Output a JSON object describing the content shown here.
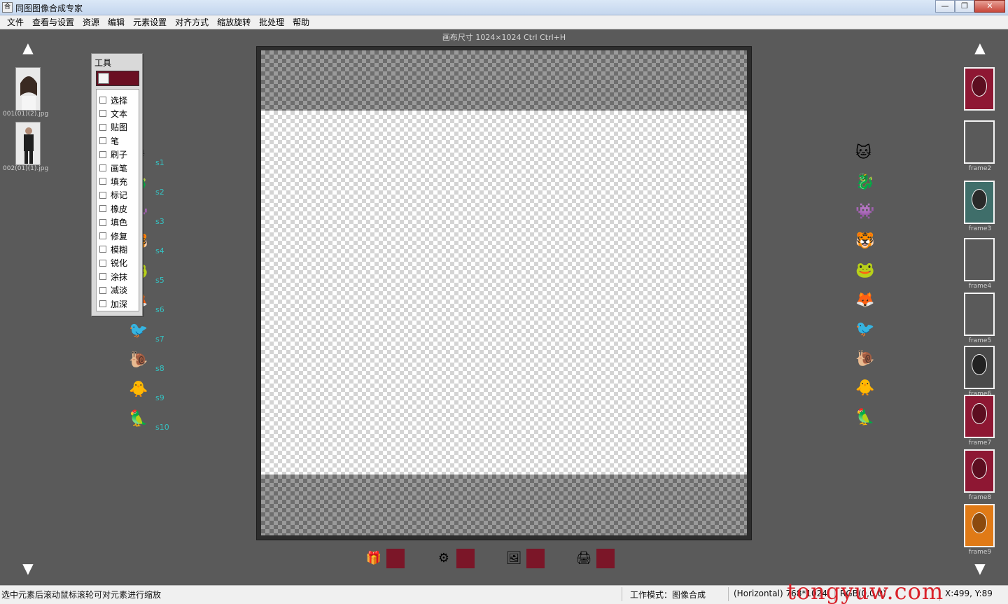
{
  "window": {
    "icon_text": "合",
    "title": "同图图像合成专家",
    "btn_min": "—",
    "btn_max": "❐",
    "btn_close": "✕"
  },
  "menu": [
    "文件",
    "查看与设置",
    "资源",
    "编辑",
    "元素设置",
    "对齐方式",
    "缩放旋转",
    "批处理",
    "帮助"
  ],
  "canvas": {
    "caption": "画布尺寸 1024×1024  Ctrl  Ctrl+H"
  },
  "left_panel": {
    "thumbs": [
      {
        "label": "001(01)(2).jpg",
        "icon": "portrait-photo-icon"
      },
      {
        "label": "002(01)(1).jpg",
        "icon": "groom-photo-icon"
      }
    ]
  },
  "tool_panel": {
    "title": "工具",
    "options": [
      "选择",
      "文本",
      "贴图",
      "笔",
      "刷子",
      "画笔",
      "填充",
      "标记",
      "橡皮",
      "填色",
      "修复",
      "模糊",
      "锐化",
      "涂抹",
      "减淡",
      "加深"
    ]
  },
  "stickers_left": [
    {
      "icon": "purple-cat-icon",
      "glyph": "🐱",
      "label": "s1"
    },
    {
      "icon": "blue-dragon-icon",
      "glyph": "🐉",
      "label": "s2"
    },
    {
      "icon": "cyan-monster-icon",
      "glyph": "👾",
      "label": "s3"
    },
    {
      "icon": "tiger-icon",
      "glyph": "🐯",
      "label": "s4"
    },
    {
      "icon": "frog-icon",
      "glyph": "🐸",
      "label": "s5"
    },
    {
      "icon": "fox-icon",
      "glyph": "🦊",
      "label": "s6"
    },
    {
      "icon": "blue-bird-icon",
      "glyph": "🐦",
      "label": "s7"
    },
    {
      "icon": "snail-icon",
      "glyph": "🐌",
      "label": "s8"
    },
    {
      "icon": "yellow-chick-icon",
      "glyph": "🐥",
      "label": "s9"
    },
    {
      "icon": "parrot-icon",
      "glyph": "🦜",
      "label": "s10"
    }
  ],
  "stickers_right": [
    {
      "icon": "purple-cat-icon",
      "glyph": "🐱"
    },
    {
      "icon": "blue-dragon-icon",
      "glyph": "🐉"
    },
    {
      "icon": "cyan-monster-icon",
      "glyph": "👾"
    },
    {
      "icon": "tiger-icon",
      "glyph": "🐯"
    },
    {
      "icon": "frog-icon",
      "glyph": "🐸"
    },
    {
      "icon": "fox-icon",
      "glyph": "🦊"
    },
    {
      "icon": "blue-bird-icon",
      "glyph": "🐦"
    },
    {
      "icon": "snail-icon",
      "glyph": "🐌"
    },
    {
      "icon": "yellow-chick-icon",
      "glyph": "🐥"
    },
    {
      "icon": "parrot-icon",
      "glyph": "🦜"
    }
  ],
  "templates": [
    {
      "label": "",
      "color": "#8e1733",
      "hole": "#5c0e20"
    },
    {
      "label": "frame2",
      "color": "transparent",
      "hole": "transparent"
    },
    {
      "label": "frame3",
      "color": "#3f6e6a",
      "hole": "#2a2a2a"
    },
    {
      "label": "frame4",
      "color": "transparent",
      "hole": "transparent"
    },
    {
      "label": "frame5",
      "color": "transparent",
      "hole": "transparent"
    },
    {
      "label": "frame6",
      "color": "#4a4a4a",
      "hole": "#222"
    },
    {
      "label": "frame7",
      "color": "#8e1733",
      "hole": "#5c0e20"
    },
    {
      "label": "frame8",
      "color": "#8e1733",
      "hole": "#5c0e20"
    },
    {
      "label": "frame9",
      "color": "#e07a16",
      "hole": "#8b4a0e"
    }
  ],
  "bottom_tools": [
    {
      "icon": "gift-box-icon",
      "glyph": "🎁"
    },
    {
      "icon": "gear-settings-icon",
      "glyph": "⚙"
    },
    {
      "icon": "photo-album-icon",
      "glyph": "🖼"
    },
    {
      "icon": "print-icon",
      "glyph": "🖨"
    }
  ],
  "arrows": {
    "up": "▲",
    "down": "▼"
  },
  "status": {
    "hint": "选中元素后滚动鼠标滚轮可对元素进行缩放",
    "mode": "工作模式：图像合成",
    "size": "(Horizontal) 768*1024",
    "rgb": "RGB(0,0,0)",
    "coord": "X:499, Y:89"
  },
  "watermark": "tongyuw.com"
}
